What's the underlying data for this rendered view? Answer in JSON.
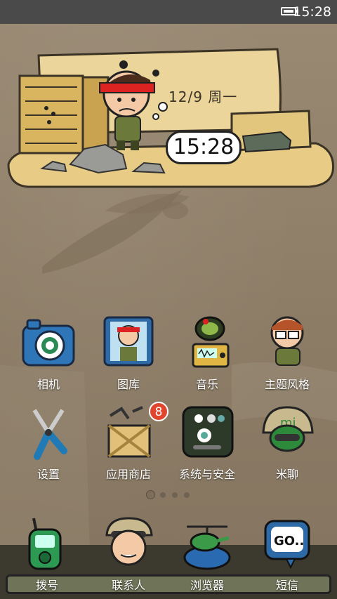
{
  "status_bar": {
    "time": "15:28"
  },
  "widget": {
    "date": "12/9 周一",
    "clock": "15:28"
  },
  "apps": [
    {
      "label": "相机",
      "icon": "camera-icon"
    },
    {
      "label": "图库",
      "icon": "gallery-icon"
    },
    {
      "label": "音乐",
      "icon": "radio-music-icon"
    },
    {
      "label": "主题风格",
      "icon": "theme-icon"
    },
    {
      "label": "设置",
      "icon": "pliers-settings-icon"
    },
    {
      "label": "应用商店",
      "icon": "crate-store-icon",
      "badge": "8"
    },
    {
      "label": "系统与安全",
      "icon": "security-panel-icon"
    },
    {
      "label": "米聊",
      "icon": "soldier-chat-icon"
    }
  ],
  "dock": [
    {
      "label": "拨号",
      "icon": "walkie-talkie-phone-icon"
    },
    {
      "label": "联系人",
      "icon": "soldier-contacts-icon"
    },
    {
      "label": "浏览器",
      "icon": "helicopter-browser-icon"
    },
    {
      "label": "短信",
      "icon": "go-sms-icon"
    }
  ],
  "colors": {
    "badge": "#e0452e",
    "wallpaper": "#8f7f68",
    "status_bar": "#4a4a4a"
  }
}
